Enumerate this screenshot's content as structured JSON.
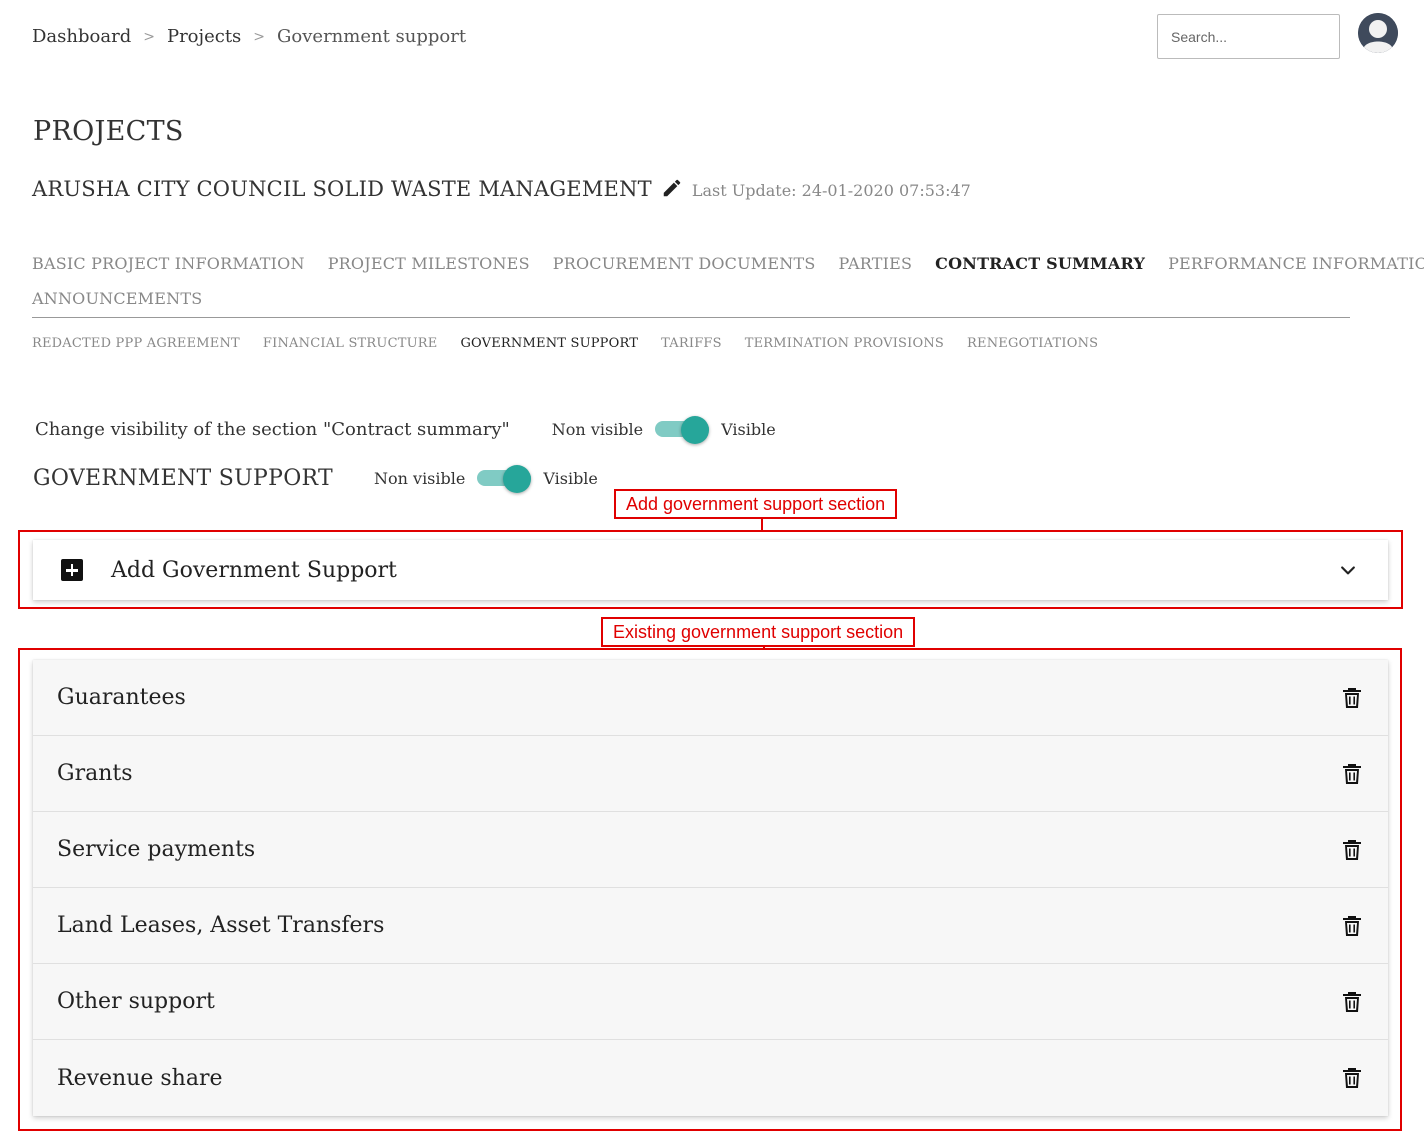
{
  "breadcrumb": {
    "items": [
      {
        "label": "Dashboard"
      },
      {
        "label": "Projects"
      },
      {
        "label": "Government support"
      }
    ],
    "separator": ">"
  },
  "search": {
    "placeholder": "Search..."
  },
  "page": {
    "title": "PROJECTS",
    "project_name": "ARUSHA CITY COUNCIL SOLID WASTE MANAGEMENT",
    "last_update": "Last Update: 24-01-2020 07:53:47"
  },
  "tabs": [
    {
      "label": "BASIC PROJECT INFORMATION",
      "active": false
    },
    {
      "label": "PROJECT MILESTONES",
      "active": false
    },
    {
      "label": "PROCUREMENT DOCUMENTS",
      "active": false
    },
    {
      "label": "PARTIES",
      "active": false
    },
    {
      "label": "CONTRACT SUMMARY",
      "active": true
    },
    {
      "label": "PERFORMANCE INFORMATION",
      "active": false
    },
    {
      "label": "ANNOUNCEMENTS",
      "active": false
    }
  ],
  "subtabs": [
    {
      "label": "REDACTED PPP AGREEMENT",
      "active": false
    },
    {
      "label": "FINANCIAL STRUCTURE",
      "active": false
    },
    {
      "label": "GOVERNMENT SUPPORT",
      "active": true
    },
    {
      "label": "TARIFFS",
      "active": false
    },
    {
      "label": "TERMINATION PROVISIONS",
      "active": false
    },
    {
      "label": "RENEGOTIATIONS",
      "active": false
    }
  ],
  "visibility": {
    "contract_summary": {
      "label": "Change visibility of the section \"Contract summary\"",
      "off_label": "Non visible",
      "on_label": "Visible",
      "state": "on"
    },
    "government_support": {
      "title": "GOVERNMENT SUPPORT",
      "off_label": "Non visible",
      "on_label": "Visible",
      "state": "on"
    }
  },
  "annotations": {
    "add_section": "Add government support section",
    "existing_section": "Existing government support section",
    "color": "#e00000"
  },
  "add_card": {
    "label": "Add Government Support",
    "icon": "plus-box-icon",
    "expand_icon": "chevron-down-icon"
  },
  "support_items": [
    {
      "name": "Guarantees"
    },
    {
      "name": "Grants"
    },
    {
      "name": "Service payments"
    },
    {
      "name": "Land Leases, Asset Transfers"
    },
    {
      "name": "Other support"
    },
    {
      "name": "Revenue share"
    }
  ],
  "colors": {
    "toggle_track": "#80cbc4",
    "toggle_knob": "#26a69a",
    "annotation": "#e00000"
  }
}
